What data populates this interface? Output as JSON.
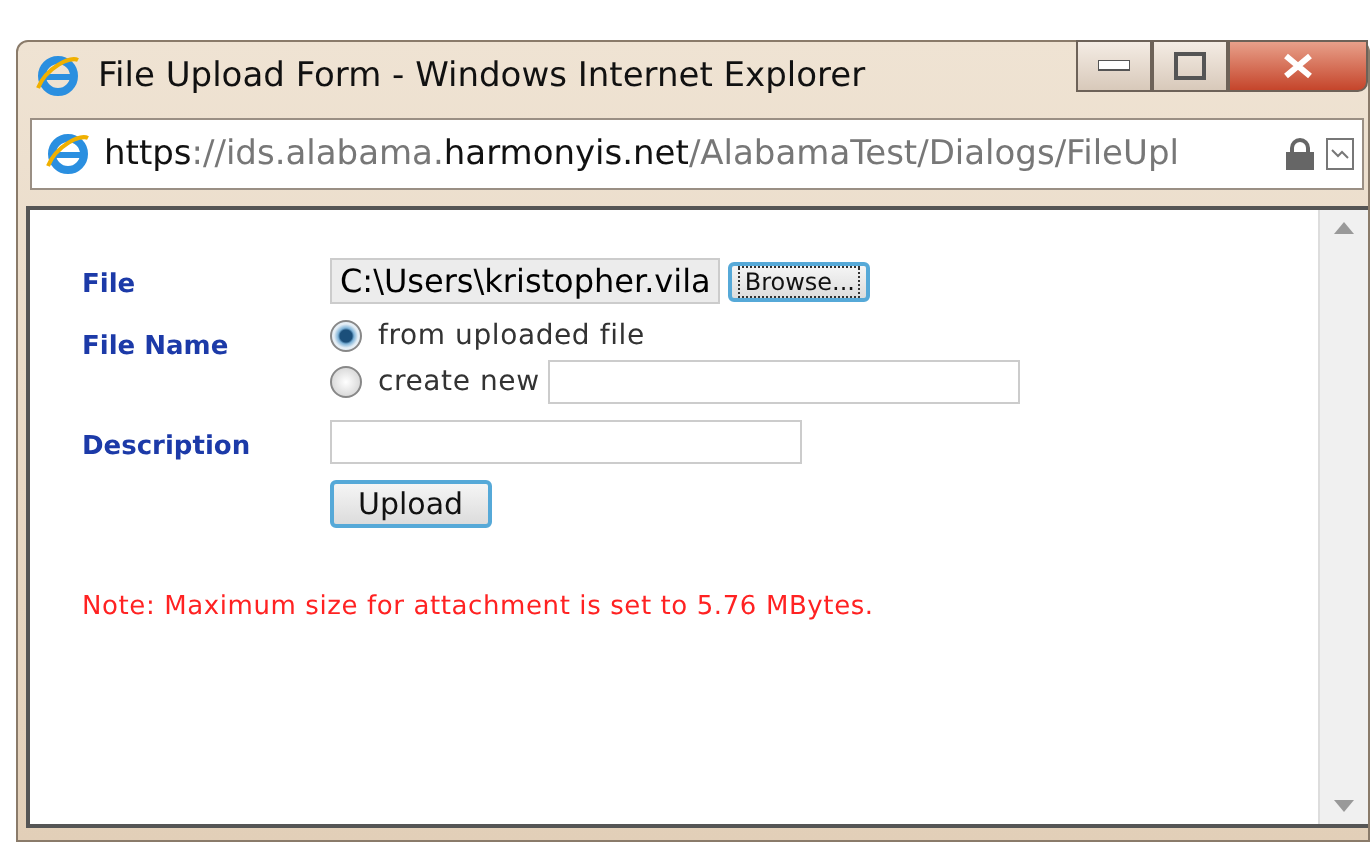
{
  "window": {
    "title": "File Upload Form - Windows Internet Explorer"
  },
  "address_bar": {
    "url": "**https**://ids.alabama.**harmonyis.net**/AlabamaTest/Dialogs/FileUpl"
  },
  "form": {
    "file": {
      "label": "File",
      "value": "C:\\Users\\kristopher.vila",
      "browse_button": "Browse..."
    },
    "file_name": {
      "label": "File Name",
      "options": [
        {
          "label": "from uploaded file",
          "selected": true,
          "kind": "plain"
        },
        {
          "label": "create new",
          "selected": false,
          "kind": "input"
        }
      ]
    },
    "description": {
      "label": "Description"
    },
    "upload_button": "Upload",
    "note": "Note: Maximum size for attachment is set to 5.76 MBytes."
  }
}
